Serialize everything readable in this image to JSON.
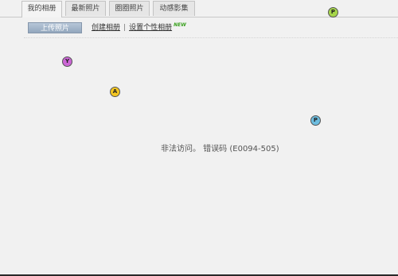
{
  "tabs": [
    {
      "label": "我的相册",
      "active": true
    },
    {
      "label": "最新照片",
      "active": false
    },
    {
      "label": "圈圈照片",
      "active": false
    },
    {
      "label": "动感影集",
      "active": false
    }
  ],
  "toolbar": {
    "upload_label": "上传照片",
    "create_album_label": "创建相册",
    "separator": "|",
    "personalize_label": "设置个性相册",
    "new_badge": "NEW"
  },
  "markers": {
    "y": "Y",
    "a": "A",
    "p1": "P",
    "p2": "P"
  },
  "error": {
    "message": "非法访问。 错误码 (E0094-505)"
  },
  "colors": {
    "background": "#f1f1f1",
    "upload_button": "#93a7bd",
    "new_badge": "#3aa11f",
    "marker_y": "#cc66d6",
    "marker_a": "#f3c623",
    "marker_p1": "#6cbcdf",
    "marker_p2": "#a6d64a"
  }
}
